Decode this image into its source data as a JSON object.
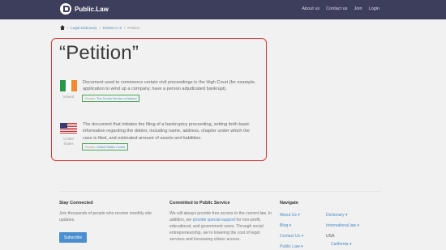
{
  "header": {
    "brand": "Public.Law",
    "nav": [
      "About us",
      "Contact us",
      "Join",
      "Login"
    ]
  },
  "breadcrumb": {
    "items": [
      "Legal Dictionary",
      "Entries A–Z",
      "Petition"
    ],
    "separator": "/"
  },
  "term": {
    "title": "“Petition”"
  },
  "definitions": [
    {
      "country": "Ireland",
      "text": "Document used to commence certain civil proceedings in the High Court (for example, application to wind up a company, have a person adjudicated bankrupt).",
      "source_label": "Source:",
      "source_name": "The Courts Service of Ireland",
      "flag_colors": [
        "#2a9a4a",
        "#ffffff",
        "#f08b2f"
      ]
    },
    {
      "country": "United States",
      "text": "The document that initiates the filing of a bankruptcy proceeding, setting forth basic information regarding the debtor, including name, address, chapter under which the case is filed, and estimated amount of assets and liabilities.",
      "source_label": "Source:",
      "source_name": "United States Courts"
    }
  ],
  "footer": {
    "stay_connected": {
      "heading": "Stay Connected",
      "text": "Join thousands of people who receive monthly site updates.",
      "button": "Subscribe"
    },
    "committed": {
      "heading": "Committed to Public Service",
      "text_1": "We will always provide free access to the current law. In addition, we ",
      "link": "provide special support",
      "text_2": " for non-profit, educational, and government users. Through social entrepreneurship, we’re lowering the cost of legal services and increasing citizen access."
    },
    "navigate": {
      "heading": "Navigate",
      "col1": [
        "About Us",
        "Blog",
        "Contact Us",
        "Public Law"
      ],
      "col2_links": [
        "Dictionary",
        "International law"
      ],
      "col2_plain": "USA",
      "col2_sub": "California"
    }
  },
  "colors": {
    "topbar": "#3d3d5c",
    "highlight_border": "#e03737",
    "source_border": "#4aa85a",
    "link": "#4a8cc5"
  }
}
